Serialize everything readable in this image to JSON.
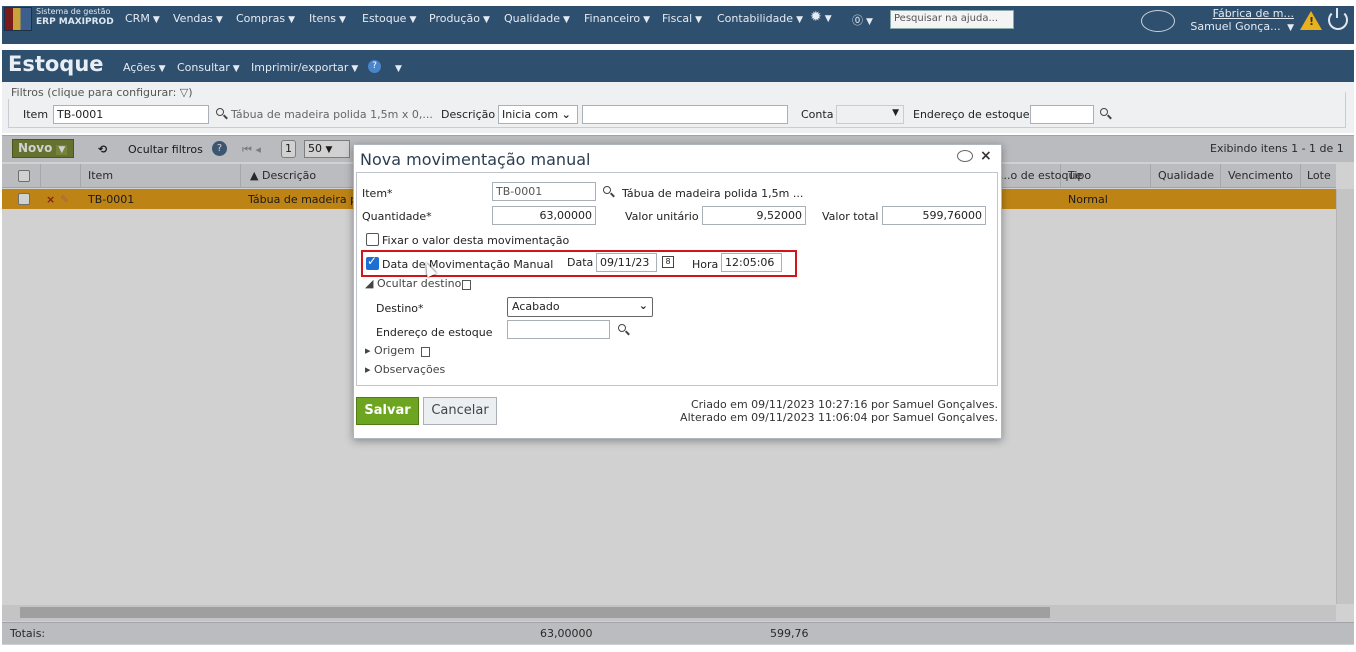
{
  "app": {
    "system_line1": "Sistema de gestão",
    "system_line2": "ERP MAXIPROD",
    "menu": [
      "CRM",
      "Vendas",
      "Compras",
      "Itens",
      "Estoque",
      "Produção",
      "Qualidade",
      "Financeiro",
      "Fiscal",
      "Contabilidade"
    ],
    "help_placeholder": "Pesquisar na ajuda...",
    "company": "Fábrica de m...",
    "user": "Samuel Gonça..."
  },
  "page": {
    "title": "Estoque",
    "menus": [
      "Ações",
      "Consultar",
      "Imprimir/exportar"
    ]
  },
  "filters": {
    "legend": "Filtros (clique para configurar:",
    "item_label": "Item",
    "item_value": "TB-0001",
    "item_description": "Tábua de madeira polida 1,5m x 0,...",
    "descricao_label": "Descrição",
    "descricao_mode": "Inicia com",
    "conta_label": "Conta",
    "endereco_label": "Endereço de estoque"
  },
  "toolbar": {
    "novo": "Novo",
    "hide_filters": "Ocultar filtros",
    "page": "1",
    "page_size": "50",
    "showing": "Exibindo itens 1 - 1 de 1"
  },
  "grid": {
    "columns": [
      "Item",
      "Descrição",
      "...o de estoque",
      "Tipo",
      "Qualidade",
      "Vencimento",
      "Lote"
    ],
    "rows": [
      {
        "item": "TB-0001",
        "descricao": "Tábua de madeira p",
        "tipo": "Normal"
      }
    ],
    "totals_label": "Totais:",
    "total_qty": "63,00000",
    "total_value": "599,76"
  },
  "dialog": {
    "title": "Nova movimentação manual",
    "item_label": "Item*",
    "item_value": "TB-0001",
    "item_desc": "Tábua de madeira polida 1,5m ...",
    "qty_label": "Quantidade*",
    "qty_value": "63,00000",
    "unit_label": "Valor unitário",
    "unit_value": "9,52000",
    "total_label": "Valor total",
    "total_value": "599,76000",
    "fix_label": "Fixar o valor desta movimentação",
    "date_check_label": "Data de Movimentação Manual",
    "date_label": "Data",
    "date_value": "09/11/23",
    "hour_label": "Hora",
    "hour_value": "12:05:06",
    "hide_dest": "Ocultar destino",
    "dest_label": "Destino*",
    "dest_value": "Acabado",
    "addr_label": "Endereço de estoque",
    "origin": "Origem",
    "obs": "Observações",
    "save": "Salvar",
    "cancel": "Cancelar",
    "created": "Criado em 09/11/2023 10:27:16 por Samuel Gonçalves.",
    "altered": "Alterado em 09/11/2023 11:06:04 por Samuel Gonçalves."
  },
  "colors": {
    "nav": "#2f4f6e",
    "row_selected": "#e7a21a",
    "save": "#6ea520",
    "highlight": "#d3151b"
  }
}
